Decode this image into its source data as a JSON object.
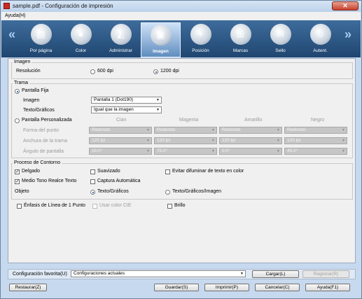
{
  "window": {
    "title": "sample.pdf - Configuración de impresión",
    "close_glyph": "✕"
  },
  "menu": {
    "help": "Ayuda(H)"
  },
  "nav": {
    "prev": "«",
    "next": "»"
  },
  "tabs": [
    {
      "label": "Por página",
      "icon": "stacked-pages-icon",
      "glyph": "▤"
    },
    {
      "label": "Color",
      "icon": "color-circles-icon",
      "glyph": "●"
    },
    {
      "label": "Administrar",
      "icon": "color-fan-icon",
      "glyph": "◭"
    },
    {
      "label": "Imagen",
      "icon": "halftone-square-icon",
      "glyph": "▣"
    },
    {
      "label": "Posición",
      "icon": "page-position-icon",
      "glyph": "⌖"
    },
    {
      "label": "Marcas",
      "icon": "crop-marks-icon",
      "glyph": "⊞"
    },
    {
      "label": "Sello",
      "icon": "stamp-page-icon",
      "glyph": "✉"
    },
    {
      "label": "Autent.",
      "icon": "users-authentication-icon",
      "glyph": "☺"
    }
  ],
  "active_tab": "Imagen",
  "imagen_group": {
    "label": "Imagen",
    "resolucion_label": "Resolución",
    "opt_600": "600 dpi",
    "opt_1200": "1200 dpi",
    "selected": "1200 dpi"
  },
  "trama": {
    "label": "Trama",
    "fija_label": "Pantalla Fija",
    "imagen_label": "Imagen",
    "imagen_value": "Pantalla 1 (Dot190)",
    "texto_label": "Texto/Gráficos",
    "texto_value": "Igual que la imagen",
    "personalizada_label": "Pantalla Personalizada",
    "columns": [
      "Cian",
      "Magenta",
      "Amarillo",
      "Negro"
    ],
    "rows": [
      {
        "label": "Forma del punto",
        "values": [
          "Redondo",
          "Redondo",
          "Redondo",
          "Redondo"
        ]
      },
      {
        "label": "Anchura de la trama",
        "values": [
          "120 lpi",
          "120 lpi",
          "120 lpi",
          "120 lpi"
        ]
      },
      {
        "label": "Ángulo de pantalla",
        "values": [
          "15.0°",
          "75.0°",
          "0.0°",
          "45.0°"
        ]
      }
    ]
  },
  "contorno": {
    "label": "Proceso de Contorno",
    "delgado": "Delgado",
    "suavizado": "Suavizado",
    "evitar": "Evitar difuminar de texto en color",
    "medio_tono": "Medio Tono Realce Texto",
    "captura": "Captura Automática",
    "objeto_label": "Objeto",
    "opt_texto": "Texto/Gráficos",
    "opt_texto_imagen": "Texto/Gráficos/Imagen",
    "objeto_selected": "Texto/Gráficos"
  },
  "extras": {
    "enfasis": "Énfasis de Línea de 1 Punto",
    "cie": "Usar color CIE",
    "brillo": "Brillo"
  },
  "favorites": {
    "label": "Configuración favorita(U)",
    "value": "Configuraciones actuales",
    "cargar": "Cargar(L)",
    "registrar": "Registrar(R)"
  },
  "buttons": {
    "restaurar": "Restaurar(Z)",
    "guardar": "Guardar(S)",
    "imprimir": "Imprimir(P)",
    "cancelar": "Cancelar(C)",
    "ayuda": "Ayuda(F1)"
  }
}
